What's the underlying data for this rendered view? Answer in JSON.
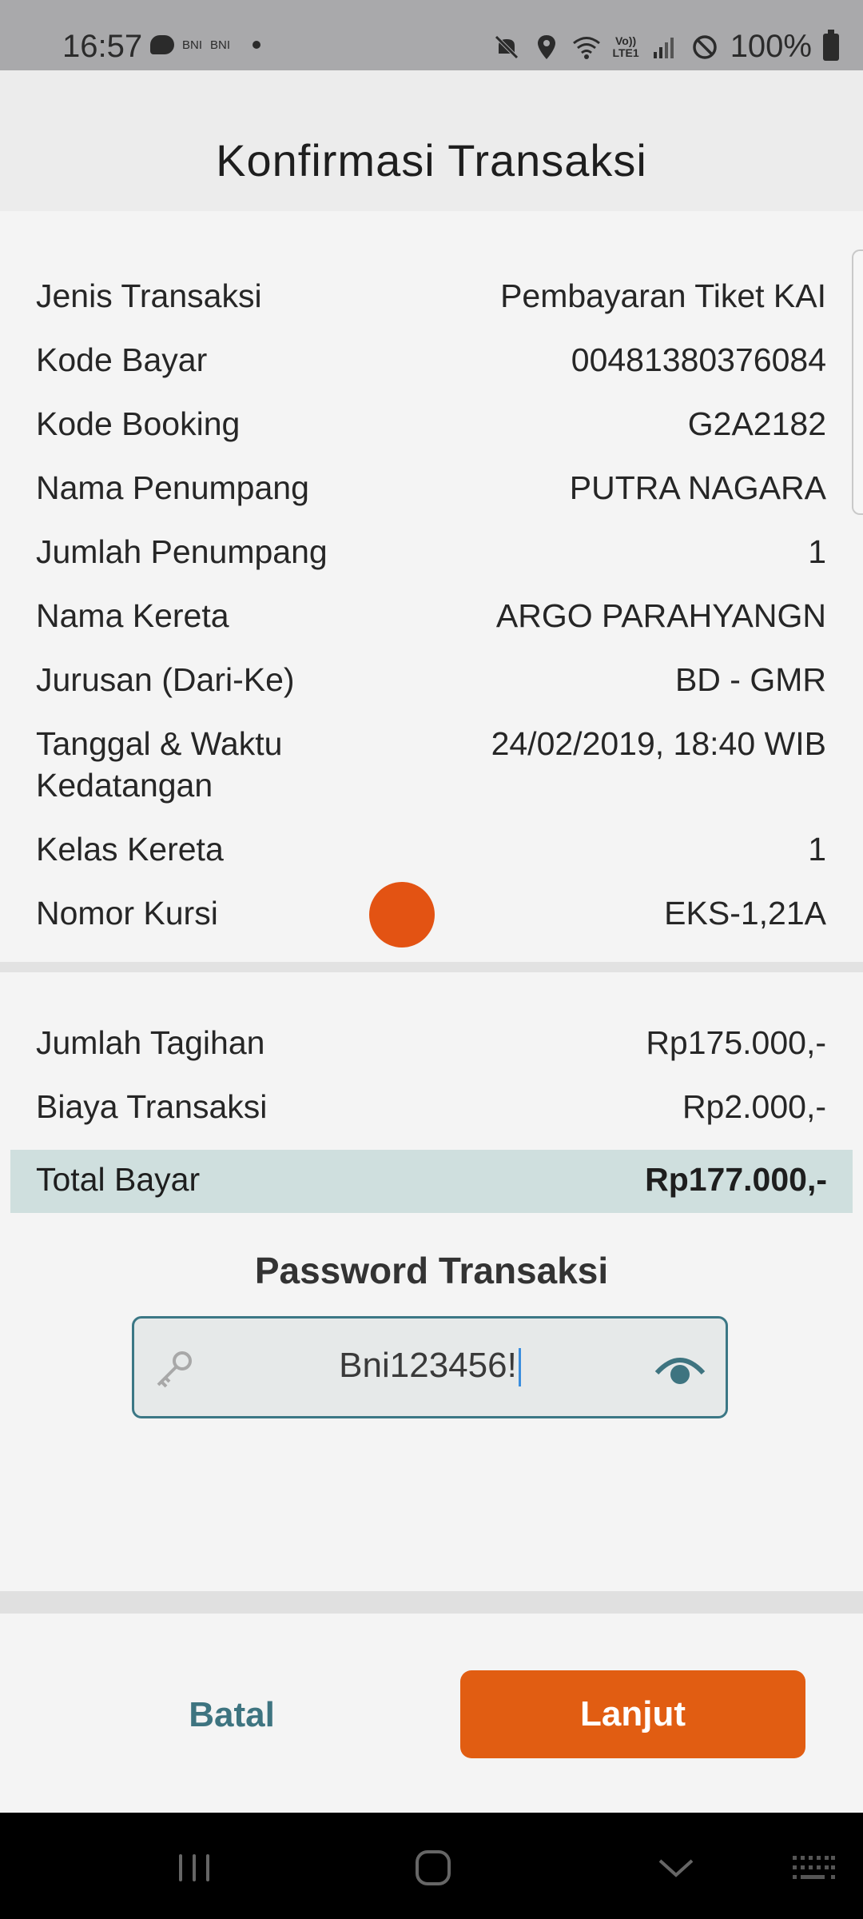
{
  "status_bar": {
    "time": "16:57",
    "notif_1": "BNI",
    "notif_2": "BNI",
    "lte_top": "Vo))",
    "lte_bottom": "LTE1",
    "battery": "100%"
  },
  "header": {
    "title": "Konfirmasi Transaksi"
  },
  "details": [
    {
      "label": "Jenis Transaksi",
      "value": "Pembayaran Tiket KAI"
    },
    {
      "label": "Kode Bayar",
      "value": "00481380376084"
    },
    {
      "label": "Kode Booking",
      "value": "G2A2182"
    },
    {
      "label": "Nama Penumpang",
      "value": "PUTRA NAGARA"
    },
    {
      "label": "Jumlah Penumpang",
      "value": "1"
    },
    {
      "label": "Nama Kereta",
      "value": "ARGO PARAHYANGN"
    },
    {
      "label": "Jurusan (Dari-Ke)",
      "value": "BD - GMR"
    },
    {
      "label_line1": "Tanggal & Waktu",
      "label_line2": "Kedatangan",
      "value": "24/02/2019, 18:40 WIB"
    },
    {
      "label": "Kelas Kereta",
      "value": "1"
    },
    {
      "label": "Nomor Kursi",
      "value": "EKS-1,21A"
    }
  ],
  "billing": [
    {
      "label": "Jumlah Tagihan",
      "value": "Rp175.000,-"
    },
    {
      "label": "Biaya Transaksi",
      "value": "Rp2.000,-"
    }
  ],
  "total": {
    "label": "Total Bayar",
    "value": "Rp177.000,-"
  },
  "password": {
    "title": "Password Transaksi",
    "value": "Bni123456!"
  },
  "actions": {
    "cancel_label": "Batal",
    "next_label": "Lanjut"
  },
  "colors": {
    "accent": "#e15d12",
    "teal": "#3e7480",
    "total_band": "#cfdfde"
  }
}
